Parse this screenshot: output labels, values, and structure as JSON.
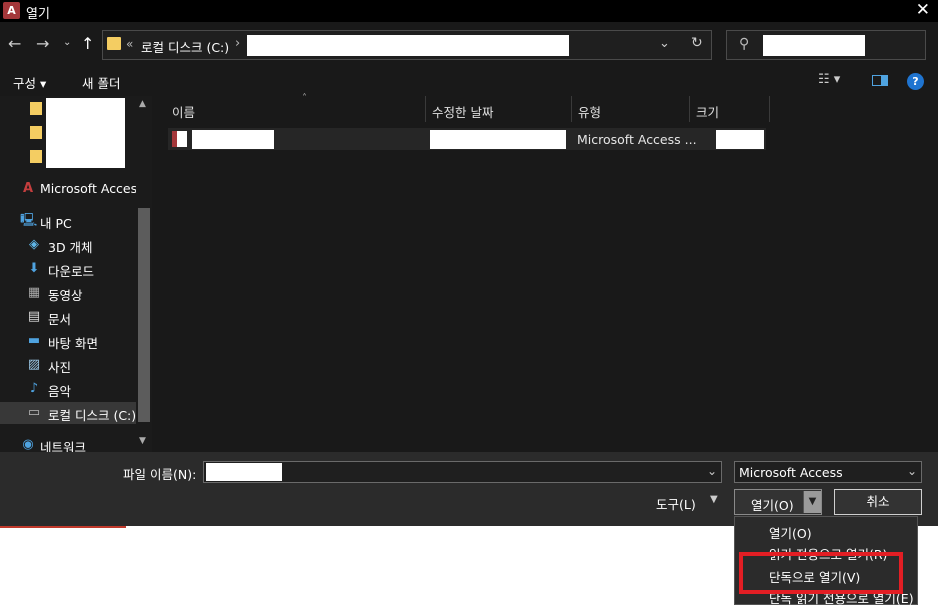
{
  "window": {
    "title": "열기",
    "app_icon_letter": "A"
  },
  "address": {
    "separator": "«",
    "path": "로컬 디스크 (C:)",
    "chevron": "›"
  },
  "toolbar": {
    "organize": "구성 ▾",
    "new_folder": "새 폴더",
    "view_glyph": "☷ ▾",
    "help": "?"
  },
  "nav": {
    "items": [
      {
        "label": "Microsoft Access",
        "icon": "access-icon"
      },
      {
        "label": "내 PC",
        "icon": "pc-icon"
      },
      {
        "label": "3D 개체",
        "icon": "cube-icon"
      },
      {
        "label": "다운로드",
        "icon": "download-icon"
      },
      {
        "label": "동영상",
        "icon": "video-icon"
      },
      {
        "label": "문서",
        "icon": "document-icon"
      },
      {
        "label": "바탕 화면",
        "icon": "desktop-icon"
      },
      {
        "label": "사진",
        "icon": "picture-icon"
      },
      {
        "label": "음악",
        "icon": "music-icon"
      },
      {
        "label": "로컬 디스크 (C:)",
        "icon": "drive-icon"
      },
      {
        "label": "네트워크",
        "icon": "network-icon"
      }
    ]
  },
  "columns": {
    "name": "이름",
    "modified": "수정한 날짜",
    "type": "유형",
    "size": "크기"
  },
  "files": [
    {
      "type": "Microsoft Access ..."
    }
  ],
  "bottom": {
    "filename_label": "파일 이름(N):",
    "filetype": "Microsoft Access",
    "tools_label": "도구(L)",
    "open_label": "열기(O)",
    "cancel_label": "취소"
  },
  "open_menu": {
    "items": [
      "열기(O)",
      "읽기 전용으로 열기(R)",
      "단독으로 열기(V)",
      "단독 읽기 전용으로 열기(E)"
    ]
  },
  "colors": {
    "accent_red": "#e31e24",
    "folder_yellow": "#f4cd62",
    "access_red": "#a4373a"
  }
}
